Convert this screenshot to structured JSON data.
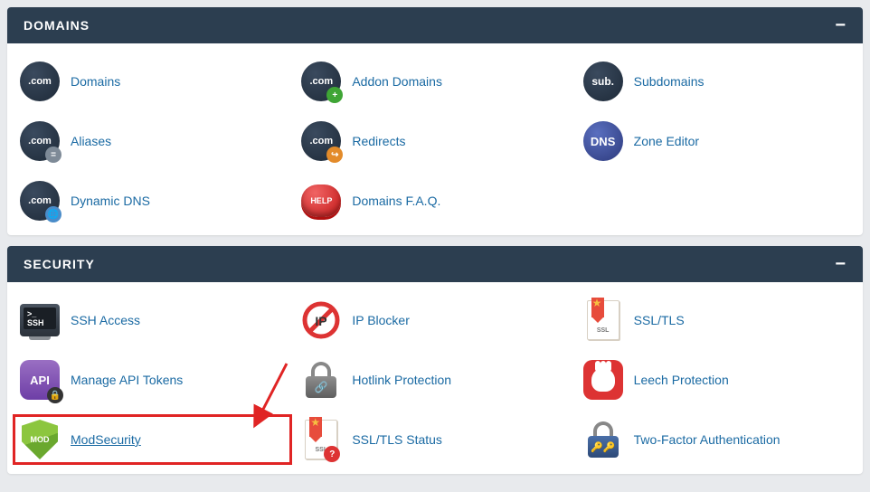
{
  "panels": {
    "domains": {
      "title": "DOMAINS",
      "items": [
        {
          "label": "Domains",
          "icon": "com-icon"
        },
        {
          "label": "Addon Domains",
          "icon": "com-plus-icon"
        },
        {
          "label": "Subdomains",
          "icon": "sub-icon"
        },
        {
          "label": "Aliases",
          "icon": "com-alias-icon"
        },
        {
          "label": "Redirects",
          "icon": "com-redirect-icon"
        },
        {
          "label": "Zone Editor",
          "icon": "dns-icon"
        },
        {
          "label": "Dynamic DNS",
          "icon": "com-dynamic-icon"
        },
        {
          "label": "Domains F.A.Q.",
          "icon": "help-icon"
        }
      ]
    },
    "security": {
      "title": "SECURITY",
      "items": [
        {
          "label": "SSH Access",
          "icon": "ssh-icon"
        },
        {
          "label": "IP Blocker",
          "icon": "ip-blocker-icon"
        },
        {
          "label": "SSL/TLS",
          "icon": "ssl-tls-icon"
        },
        {
          "label": "Manage API Tokens",
          "icon": "api-icon"
        },
        {
          "label": "Hotlink Protection",
          "icon": "hotlink-icon"
        },
        {
          "label": "Leech Protection",
          "icon": "leech-icon"
        },
        {
          "label": "ModSecurity",
          "icon": "modsecurity-icon",
          "highlighted": true
        },
        {
          "label": "SSL/TLS Status",
          "icon": "ssl-status-icon"
        },
        {
          "label": "Two-Factor Authentication",
          "icon": "two-factor-icon"
        }
      ]
    }
  },
  "icon_text": {
    "com": ".com",
    "sub": "sub.",
    "dns": "DNS",
    "help": "HELP",
    "ssh": ">_ SSH",
    "ip": "IP",
    "ssl": "SSL",
    "api": "API",
    "mod": "MOD",
    "link": "🔗",
    "keys": "🔑🔑",
    "question": "?"
  }
}
